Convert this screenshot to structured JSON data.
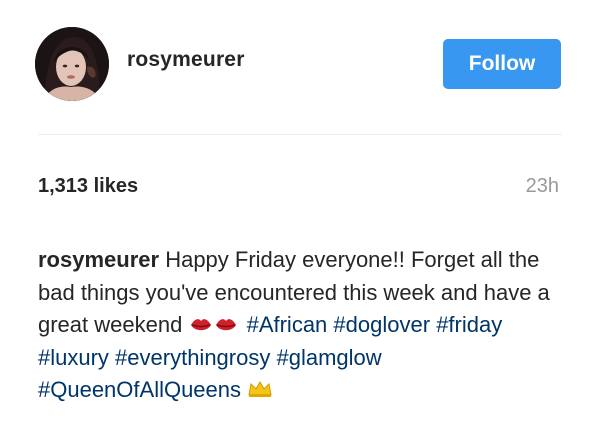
{
  "post": {
    "username": "rosymeurer",
    "follow_label": "Follow",
    "likes": "1,313 likes",
    "time": "23h",
    "caption": {
      "username": "rosymeurer",
      "text": "Happy Friday everyone!! Forget all the bad things you've encountered this week and have a great weekend",
      "emoji_1": "kiss-lips-icon",
      "hashtags": [
        "#African",
        "#doglover",
        "#friday",
        "#luxury",
        "#everythingrosy",
        "#glamglow",
        "#QueenOfAllQueens"
      ],
      "emoji_2": "crown-icon"
    }
  },
  "colors": {
    "follow_button": "#3897f0",
    "hashtag": "#003569",
    "time": "#999999",
    "divider": "#efefef"
  }
}
